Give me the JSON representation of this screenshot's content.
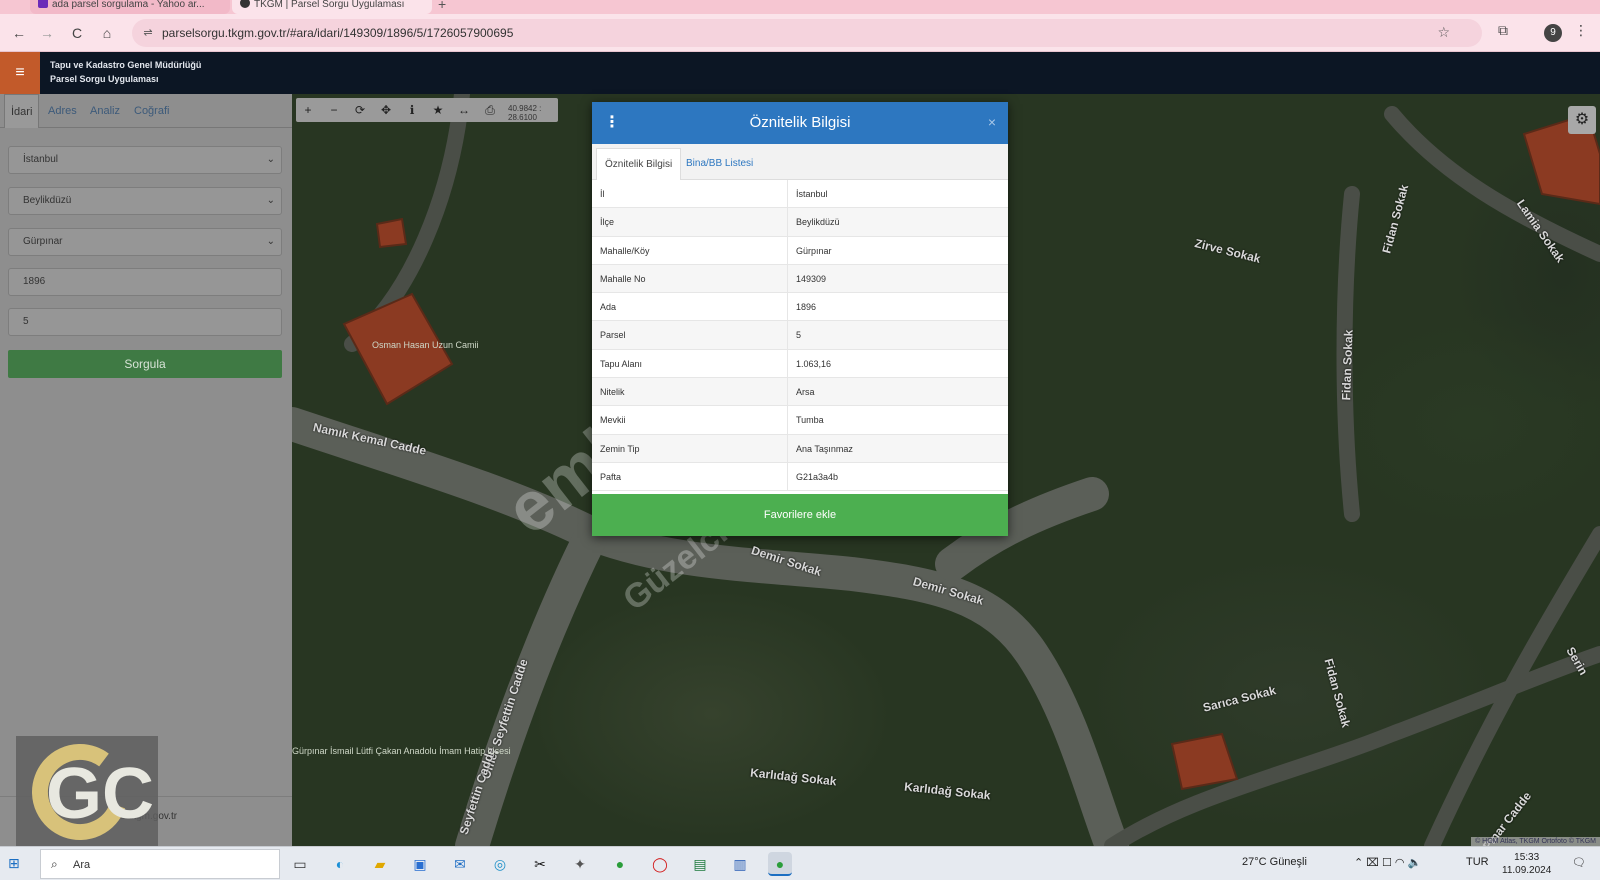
{
  "browser": {
    "tabs": [
      {
        "label": "ada parsel sorgulama - Yahoo ar..."
      },
      {
        "label": "TKGM | Parsel Sorgu Uygulaması"
      }
    ],
    "new_tab": "+",
    "back": "←",
    "forward": "→",
    "reload": "C",
    "home": "⌂",
    "url": "parselsorgu.tkgm.gov.tr/#ara/idari/149309/1896/5/1726057900695",
    "site_icon": "⇌",
    "star": "☆",
    "extensions": "⧉",
    "profile": "9",
    "menu": "⋮"
  },
  "app": {
    "menu_icon": "≡",
    "title_line1": "Tapu ve Kadastro Genel Müdürlüğü",
    "title_line2": "Parsel Sorgu Uygulaması"
  },
  "sidebar": {
    "tabs": [
      "İdari",
      "Adres",
      "Analiz",
      "Coğrafi"
    ],
    "il": "İstanbul",
    "ilce": "Beylikdüzü",
    "mahalle": "Gürpınar",
    "ada": "1896",
    "parsel": "5",
    "query_button": "Sorgula",
    "footer_link": "cbs.tkgm.gov.tr",
    "chevron": "⌄"
  },
  "map": {
    "coords": "40.9842 : 28.6100",
    "tools": [
      "+",
      "−",
      "⟳",
      "✥",
      "ℹ",
      "★",
      "↔",
      "⎙"
    ],
    "gear": "⚙",
    "attribution": "© HGM Atlas, TKGM Ortofoto © TKGM",
    "road_labels": [
      "Namık Kemal Cadde",
      "Demir Sokak",
      "Demir Sokak",
      "Zirve Sokak",
      "Fidan Sokak",
      "Lamia Sokak",
      "Fidan Sokak",
      "Sarıca Sokak",
      "Karlıdağ Sokak",
      "Karlıdağ Sokak",
      "Ömer Seyfettin Cadde",
      "Fidan Sokak",
      "Seyfettin Cadde",
      "Pınar Cadde",
      "Serin"
    ],
    "poi": [
      "Osman Hasan Uzun Camii",
      "Gürpınar İsmail Lütfi Çakan Anadolu İmam Hatip Lisesi"
    ]
  },
  "modal": {
    "menu": "⋮",
    "title": "Öznitelik Bilgisi",
    "close": "×",
    "tabs": [
      "Öznitelik Bilgisi",
      "Bina/BB Listesi"
    ],
    "rows": [
      {
        "key": "İl",
        "value": "İstanbul"
      },
      {
        "key": "İlçe",
        "value": "Beylikdüzü"
      },
      {
        "key": "Mahalle/Köy",
        "value": "Gürpınar"
      },
      {
        "key": "Mahalle No",
        "value": "149309"
      },
      {
        "key": "Ada",
        "value": "1896"
      },
      {
        "key": "Parsel",
        "value": "5"
      },
      {
        "key": "Tapu Alanı",
        "value": "1.063,16"
      },
      {
        "key": "Nitelik",
        "value": "Arsa"
      },
      {
        "key": "Mevkii",
        "value": "Tumba"
      },
      {
        "key": "Zemin Tip",
        "value": "Ana Taşınmaz"
      },
      {
        "key": "Pafta",
        "value": "G21a3a4b"
      }
    ],
    "favorite_button": "Favorilere ekle"
  },
  "watermark": {
    "main": "emlakjet.com",
    "sub": "Güzelciler Emlak",
    "logo": "GC"
  },
  "taskbar": {
    "start": "⊞",
    "search_placeholder": "Ara",
    "search_icon": "⌕",
    "weather": "27°C  Güneşli",
    "lang": "TUR",
    "time": "15:33",
    "date": "11.09.2024",
    "tray_icons": "⌃ ⌧ ☐ ◠ 🔈",
    "notifications": "🗨"
  },
  "colors": {
    "modal_header": "#2d77c0",
    "favorite_button": "#4caf50",
    "query_button": "#3f7a44",
    "app_header": "#0c1624"
  }
}
